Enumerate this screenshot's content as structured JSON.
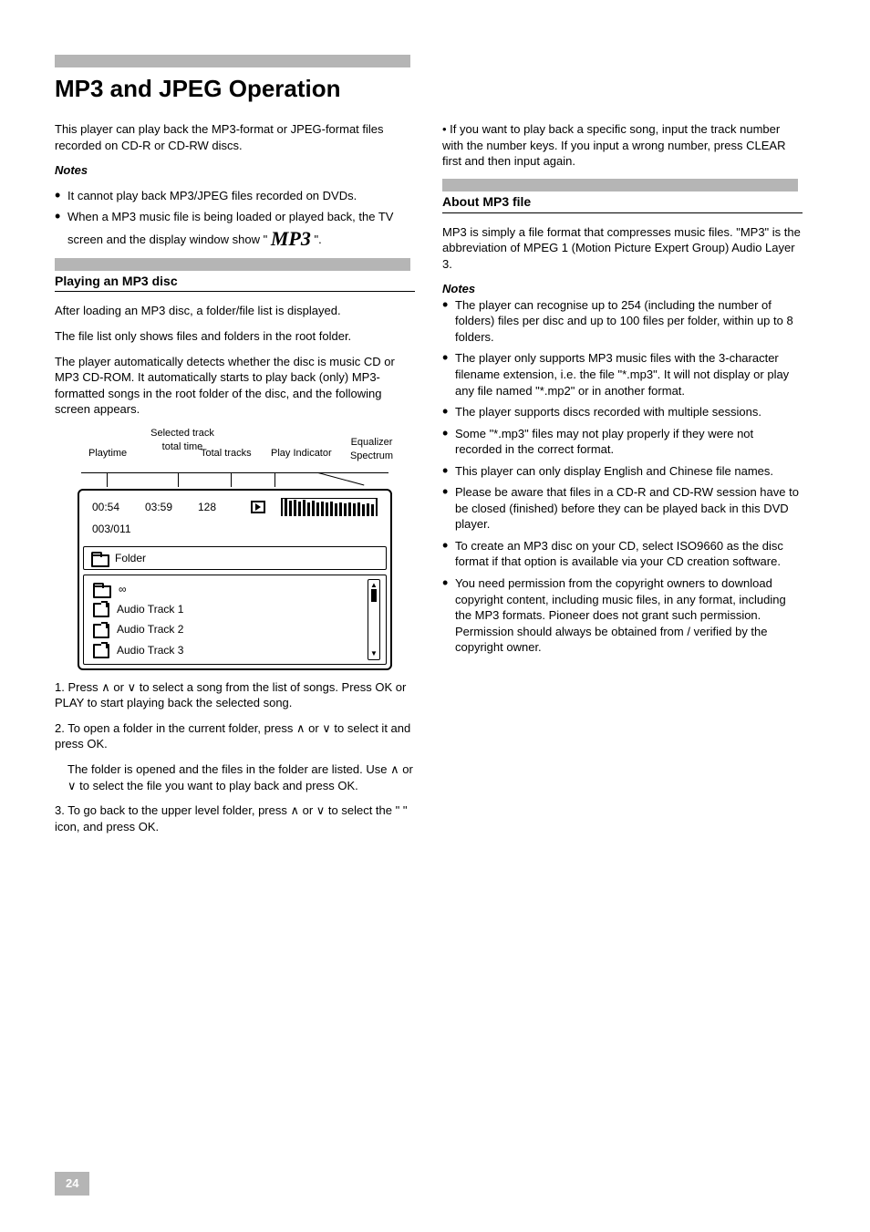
{
  "pageTitle": "MP3 and JPEG Operation",
  "leftCol": {
    "intro": "This player can play back the MP3-format or JPEG-format files recorded on CD-R or CD-RW discs.",
    "notes": [
      "It cannot play back MP3/JPEG files recorded on DVDs.",
      "When a MP3 music file is being loaded or played back, the TV screen and the display window show \""
    ],
    "notesPost": "\".",
    "heading": "Playing an MP3 disc",
    "headingSection": {
      "p1": "After loading an MP3 disc, a folder/file list is displayed.",
      "p2": "The file list only shows files and folders in the root folder.",
      "p3": "The player automatically detects whether the disc is music CD or MP3 CD-ROM. It automatically starts to play back (only) MP3-formatted songs in the root folder of the disc, and the following screen appears."
    },
    "diagram": {
      "labels": {
        "playtime": "Playtime",
        "selectedTrack": "Selected track\ntotal time",
        "totalTracks": "Total tracks",
        "playIndicator": "Play Indicator",
        "equalizer": "Equalizer\nSpectrum"
      },
      "status": {
        "playtime": "00:54",
        "totaltime": "03:59",
        "totaltracks": "128",
        "trackPos": "003/011"
      },
      "folderBar": "Folder",
      "rootSymbol": "∞",
      "tracks": [
        "Audio Track 1",
        "Audio Track 2",
        "Audio Track 3"
      ]
    },
    "step1": "1. Press ∧ or ∨ to select a song from the list of songs. Press OK or PLAY to start playing back the selected song.",
    "step2": "2. To open a folder in the current folder, press ∧ or ∨ to select it and press OK.",
    "step2b": "The folder is opened and the files in the folder are listed. Use ∧ or ∨ to select the file you want to play back and press OK.",
    "step3": "3. To go back to the upper level folder, press ∧ or ∨ to select the \"    \" icon, and press OK."
  },
  "rightCol": {
    "tip": "• If you want to play back a specific song, input the track number with the number keys. If you input a wrong number, press CLEAR first and then input again.",
    "heading": "About MP3 file",
    "headingDesc": "MP3 is simply a file format that compresses music files. \"MP3\" is the abbreviation of MPEG 1 (Motion Picture Expert Group) Audio Layer 3.",
    "notesHead": "Notes",
    "bullets": [
      "The player can recognise up to 254 (including the number of folders) files per disc and up to 100 files per folder, within up to 8 folders.",
      "The player only supports MP3 music files with the 3-character filename extension, i.e. the file \"*.mp3\". It will not display or play any file named \"*.mp2\" or in another format.",
      "The player supports discs recorded with multiple sessions.",
      "Some \"*.mp3\" files may not play properly if they were not recorded in the correct format.",
      "This player can only display English and Chinese file names.",
      "Please be aware that files in a CD-R and CD-RW session have to be closed (finished) before they can be played back in this DVD player.",
      "To create an MP3 disc on your CD, select ISO9660 as the disc format if that option is available via your CD creation software.",
      "You need permission from the copyright owners to download copyright content, including music files, in any format, including the MP3 formats. Pioneer does not grant such permission. Permission should always be obtained from / verified by the copyright owner."
    ]
  },
  "pageNumber": "24"
}
